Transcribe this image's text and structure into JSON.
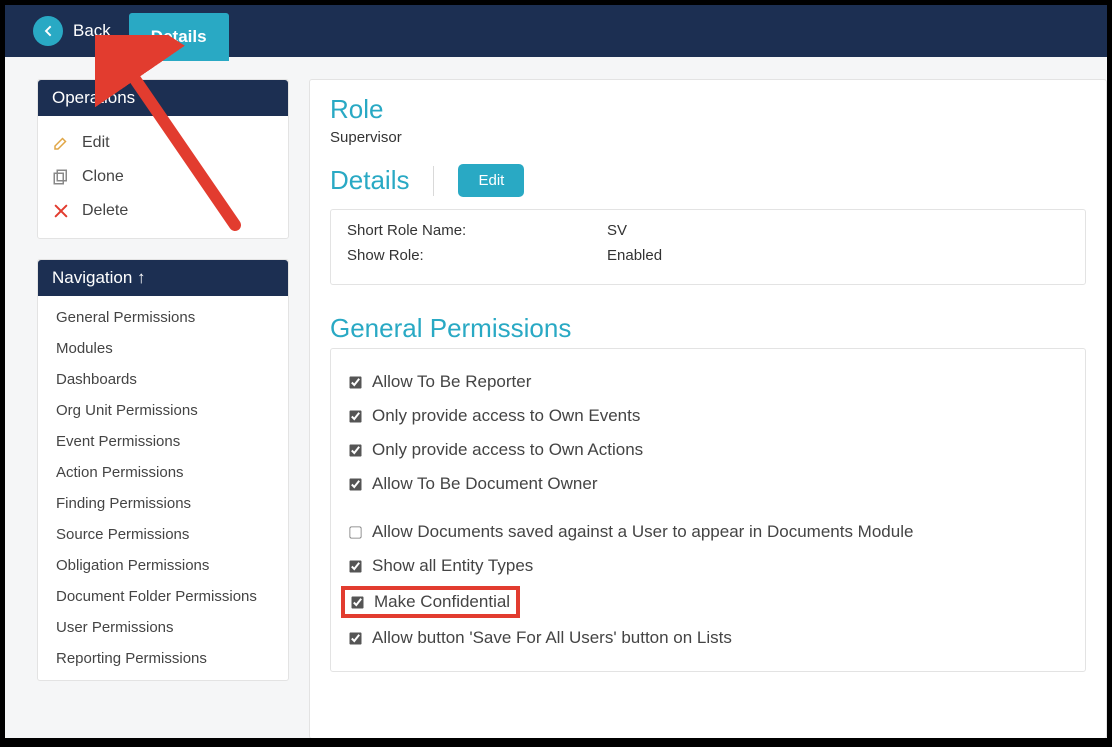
{
  "topbar": {
    "back_label": "Back",
    "tab_label": "Details"
  },
  "operations": {
    "header": "Operations",
    "items": [
      {
        "label": "Edit",
        "icon": "edit-icon"
      },
      {
        "label": "Clone",
        "icon": "clone-icon"
      },
      {
        "label": "Delete",
        "icon": "delete-icon"
      }
    ]
  },
  "navigation": {
    "header": "Navigation ↑",
    "items": [
      "General Permissions",
      "Modules",
      "Dashboards",
      "Org Unit Permissions",
      "Event Permissions",
      "Action Permissions",
      "Finding Permissions",
      "Source Permissions",
      "Obligation Permissions",
      "Document Folder Permissions",
      "User Permissions",
      "Reporting Permissions"
    ]
  },
  "main": {
    "role_heading": "Role",
    "role_value": "Supervisor",
    "details_heading": "Details",
    "edit_button": "Edit",
    "info": {
      "short_name_label": "Short Role Name:",
      "short_name_value": "SV",
      "show_role_label": "Show Role:",
      "show_role_value": "Enabled"
    },
    "gp_heading": "General Permissions",
    "permissions": [
      {
        "label": "Allow To Be Reporter",
        "checked": true
      },
      {
        "label": "Only provide access to Own Events",
        "checked": true
      },
      {
        "label": "Only provide access to Own Actions",
        "checked": true
      },
      {
        "label": "Allow To Be Document Owner",
        "checked": true
      },
      {
        "label": "Allow Documents saved against a User to appear in Documents Module",
        "checked": false,
        "gap_before": true
      },
      {
        "label": "Show all Entity Types",
        "checked": true
      },
      {
        "label": "Make Confidential",
        "checked": true,
        "highlight": true
      },
      {
        "label": "Allow button 'Save For All Users' button on Lists",
        "checked": true
      }
    ]
  }
}
